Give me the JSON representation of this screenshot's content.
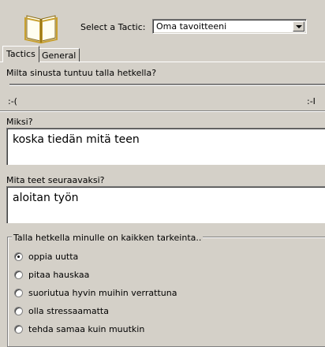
{
  "header": {
    "icon": "open-book-icon",
    "select_label": "Select a Tactic:",
    "select_value": "Oma tavoitteeni"
  },
  "tabs": [
    {
      "label": "Tactics",
      "active": true
    },
    {
      "label": "General",
      "active": false
    }
  ],
  "question1": {
    "label": "Milta sinusta tuntuu talla hetkella?",
    "scale_left": ":-(",
    "scale_right": ":-I"
  },
  "question2": {
    "label": "Miksi?",
    "value": "koska tiedän mitä teen"
  },
  "question3": {
    "label": "Mita teet seuraavaksi?",
    "value": "aloitan työn"
  },
  "priority": {
    "title": "Talla hetkella minulle on kaikken tarkeinta..",
    "options": [
      {
        "label": "oppia uutta",
        "checked": true
      },
      {
        "label": "pitaa hauskaa",
        "checked": false
      },
      {
        "label": "suoriutua hyvin muihin verrattuna",
        "checked": false
      },
      {
        "label": "olla stressaamatta",
        "checked": false
      },
      {
        "label": "tehda samaa kuin muutkin",
        "checked": false
      }
    ]
  }
}
